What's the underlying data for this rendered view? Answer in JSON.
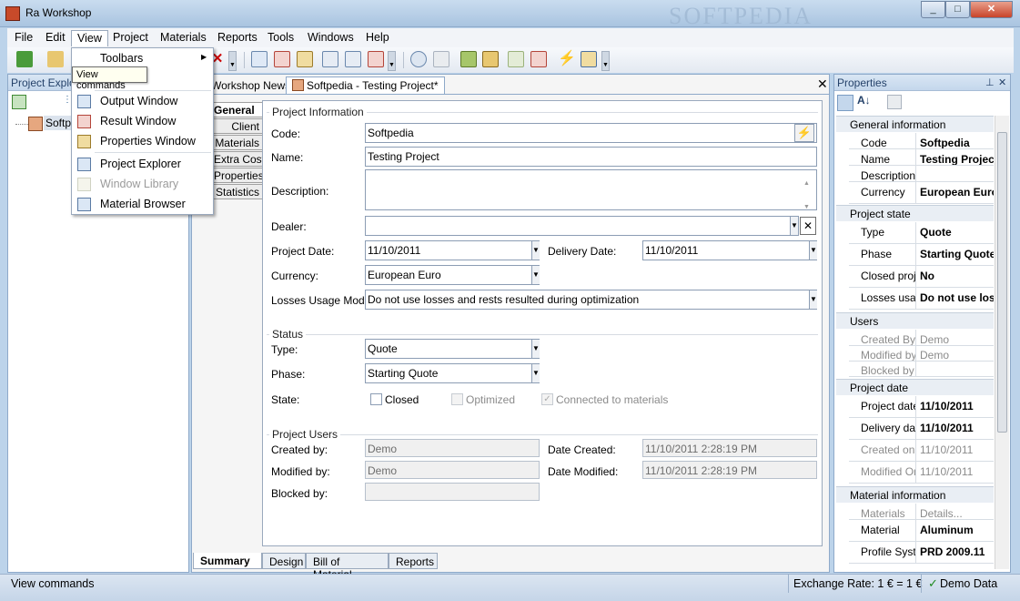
{
  "window": {
    "title": "Ra Workshop",
    "watermark": "SOFTPEDIA"
  },
  "menu": [
    "File",
    "Edit",
    "View",
    "Project",
    "Materials",
    "Reports",
    "Tools",
    "Windows",
    "Help"
  ],
  "view_menu": {
    "toolbars": "Toolbars",
    "items": [
      "Output Window",
      "Result Window",
      "Properties Window",
      "Project Explorer",
      "Window Library",
      "Material Browser"
    ],
    "tooltip": "View commands"
  },
  "explorer": {
    "title": "Project Explorer",
    "root": "Softpedia"
  },
  "doc_tabs": [
    "Workshop News",
    "Softpedia - Testing Project*"
  ],
  "left_tabs": [
    "General",
    "Client",
    "Materials",
    "Extra Costs",
    "Properties",
    "Statistics"
  ],
  "project_info": {
    "group": "Project Information",
    "code_label": "Code:",
    "code": "Softpedia",
    "name_label": "Name:",
    "name": "Testing Project",
    "description_label": "Description:",
    "dealer_label": "Dealer:",
    "project_date_label": "Project Date:",
    "project_date": "11/10/2011",
    "delivery_date_label": "Delivery Date:",
    "delivery_date": "11/10/2011",
    "currency_label": "Currency:",
    "currency": "European Euro",
    "losses_label": "Losses Usage Mode:",
    "losses": "Do not use losses and rests resulted during optimization"
  },
  "status": {
    "group": "Status",
    "type_label": "Type:",
    "type": "Quote",
    "phase_label": "Phase:",
    "phase": "Starting Quote",
    "state_label": "State:",
    "closed": "Closed",
    "optimized": "Optimized",
    "connected": "Connected to materials"
  },
  "project_users": {
    "group": "Project Users",
    "created_by_label": "Created by:",
    "created_by": "Demo",
    "modified_by_label": "Modified by:",
    "modified_by": "Demo",
    "blocked_by_label": "Blocked by:",
    "date_created_label": "Date Created:",
    "date_created": "11/10/2011 2:28:19 PM",
    "date_modified_label": "Date Modified:",
    "date_modified": "11/10/2011 2:28:19 PM"
  },
  "bottom_tabs": [
    "Summary",
    "Design",
    "Bill of Material",
    "Reports"
  ],
  "properties": {
    "title": "Properties",
    "general": "General information",
    "code_k": "Code",
    "code_v": "Softpedia",
    "name_k": "Name",
    "name_v": "Testing Project",
    "desc_k": "Description",
    "currency_k": "Currency",
    "currency_v": "European Euro",
    "state": "Project state",
    "type_k": "Type",
    "type_v": "Quote",
    "phase_k": "Phase",
    "phase_v": "Starting Quote",
    "closed_k": "Closed project",
    "closed_v": "No",
    "losses_k": "Losses usage",
    "losses_v": "Do not use losses",
    "users": "Users",
    "created_k": "Created By",
    "created_v": "Demo",
    "modified_k": "Modified by",
    "modified_v": "Demo",
    "blocked_k": "Blocked by",
    "date": "Project date",
    "pdate_k": "Project date",
    "pdate_v": "11/10/2011",
    "ddate_k": "Delivery date",
    "ddate_v": "11/10/2011",
    "con_k": "Created on",
    "con_v": "11/10/2011",
    "mon_k": "Modified On",
    "mon_v": "11/10/2011",
    "material": "Material information",
    "materials_k": "Materials",
    "materials_v": "Details...",
    "mat_k": "Material",
    "mat_v": "Aluminum",
    "profile_k": "Profile System",
    "profile_v": "PRD 2009.11"
  },
  "statusbar": {
    "left": "View commands",
    "exchange": "Exchange Rate: 1 € = 1 €",
    "mode": "Demo Data"
  }
}
